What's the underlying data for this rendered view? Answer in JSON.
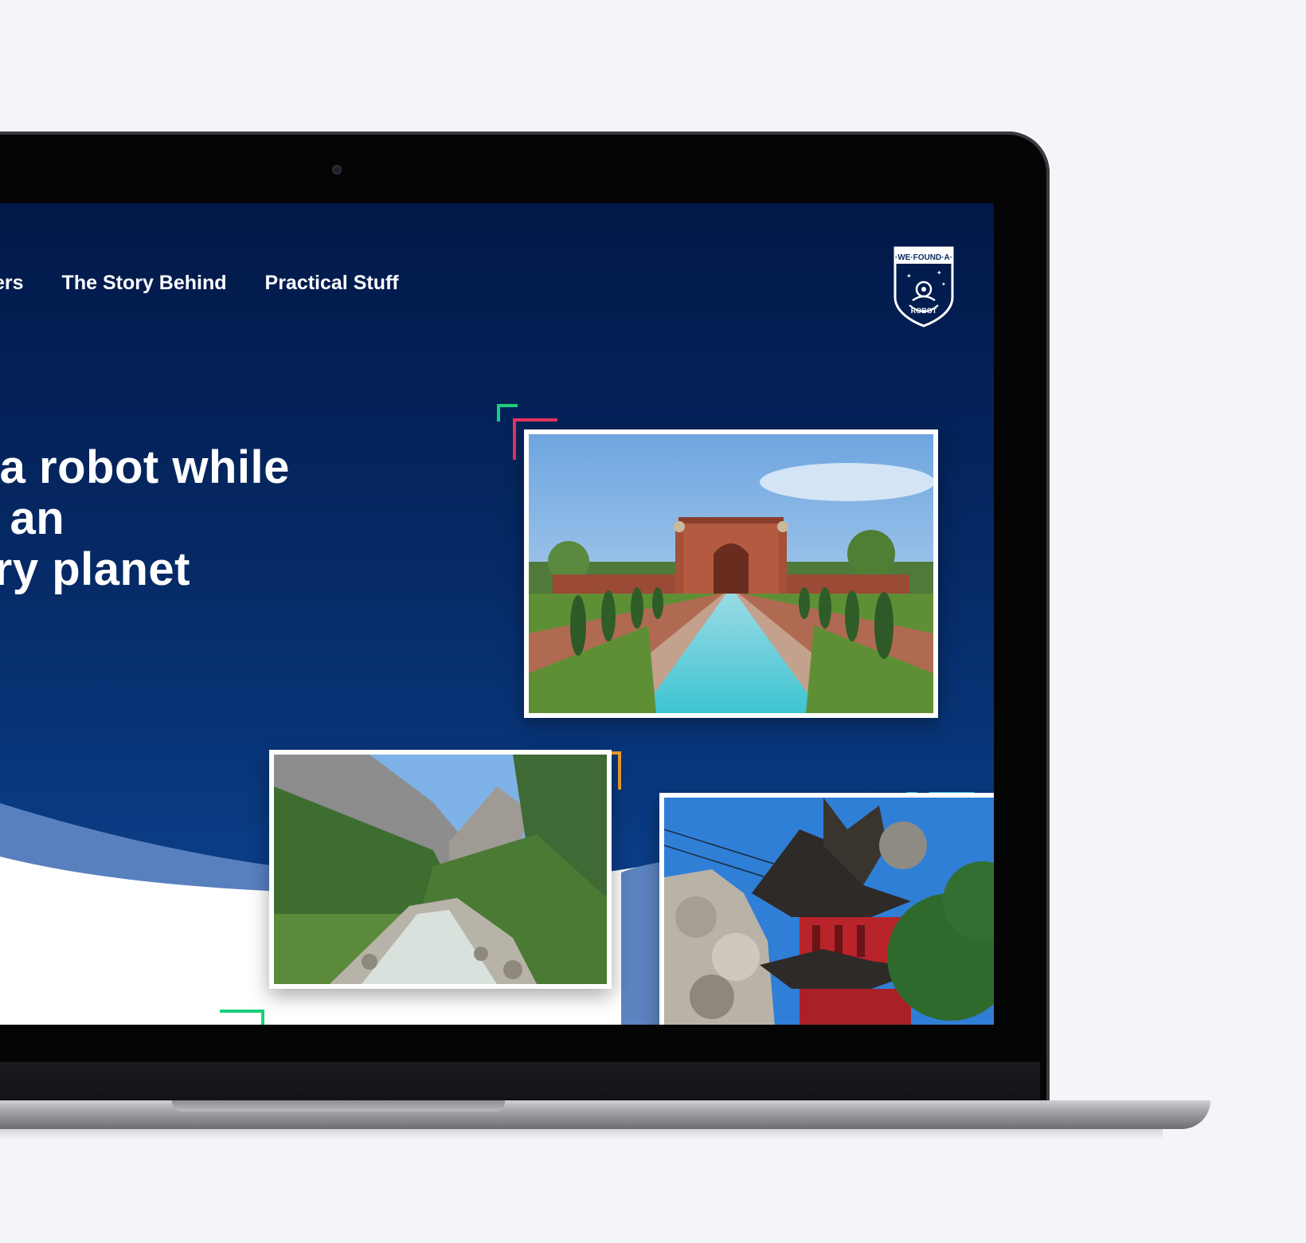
{
  "nav": {
    "item_partial": "ers",
    "item_story": "The Story Behind",
    "item_practical": "Practical Stuff"
  },
  "logo": {
    "top_text": "·WE·FOUND·A·",
    "bottom_text": "ROBOT"
  },
  "hero": {
    "line1": "r a robot while",
    "line2": "g an",
    "line3": "ary planet"
  },
  "photos": [
    {
      "subject": "red sandstone gateway with reflecting pool and gardens"
    },
    {
      "subject": "mountain valley with river and pine forest"
    },
    {
      "subject": "red pagoda roof with rock garden"
    }
  ],
  "colors": {
    "screen_top": "#021848",
    "screen_bottom": "#0b3f8a",
    "accent_green": "#19d07a",
    "accent_pink": "#e8345d",
    "accent_orange": "#f0a02a",
    "accent_cyan": "#34c3e8",
    "wave_light": "#5d84c1"
  }
}
